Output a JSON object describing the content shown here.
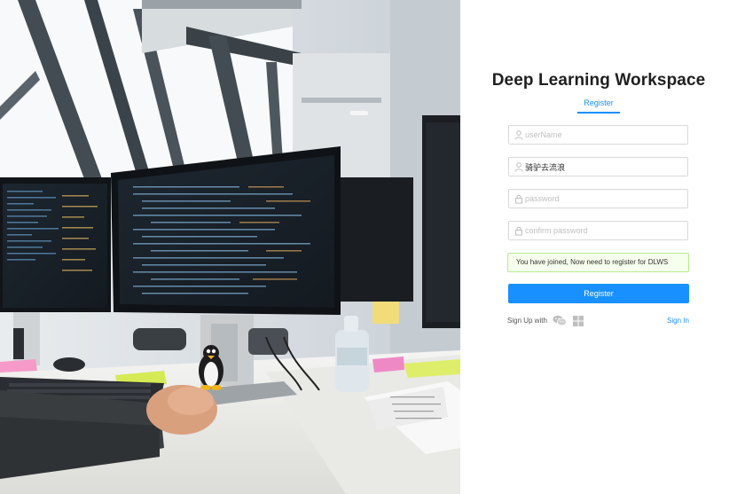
{
  "header": {
    "title": "Deep Learning Workspace",
    "active_tab": "Register"
  },
  "form": {
    "username": {
      "placeholder": "userName",
      "value": ""
    },
    "nickname": {
      "placeholder": "",
      "value": "骑驴去流浪"
    },
    "password": {
      "placeholder": "password",
      "value": ""
    },
    "confirm_password": {
      "placeholder": "confirm password",
      "value": ""
    },
    "alert": "You have joined, Now need to register for DLWS",
    "submit_label": "Register"
  },
  "footer": {
    "signup_label": "Sign Up with",
    "signin_label": "Sign In",
    "signup_icons": [
      "wechat-icon",
      "windows-icon"
    ]
  },
  "colors": {
    "accent": "#1890ff",
    "alert_bg": "#f6ffed",
    "alert_border": "#b7eb8f"
  },
  "photo": {
    "description_icon": "office-workspace-photo"
  }
}
